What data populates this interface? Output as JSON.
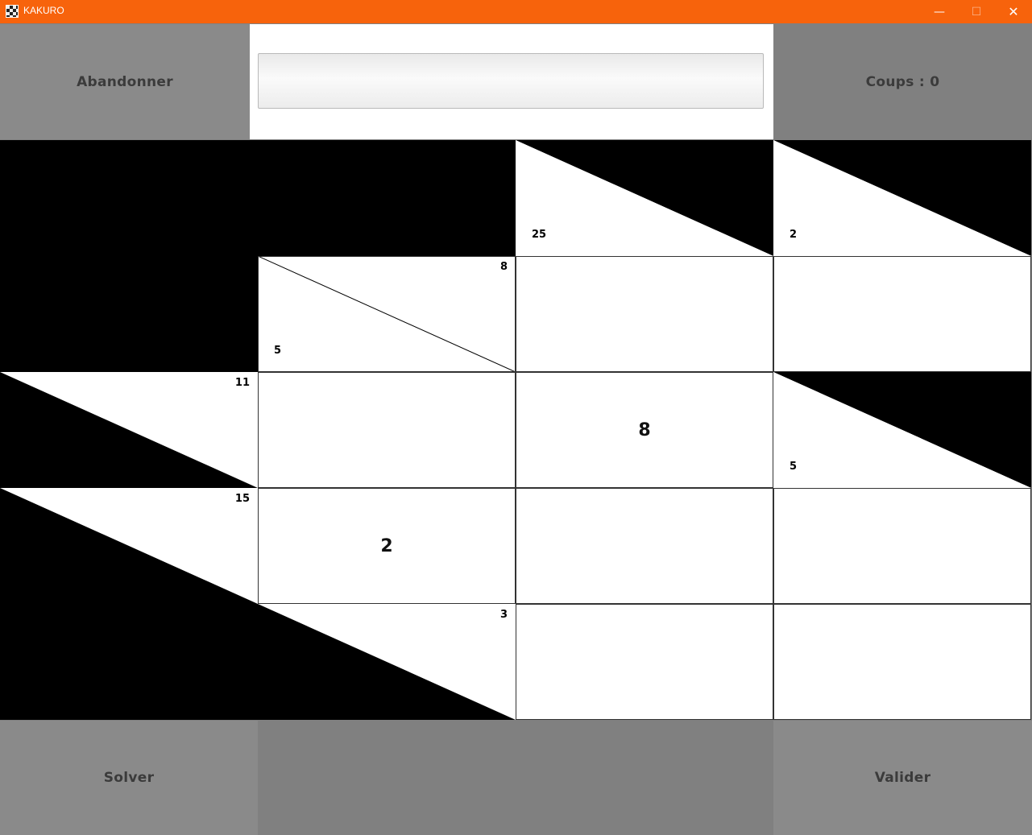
{
  "window": {
    "title": "KAKURO",
    "minimize_glyph": "—",
    "maximize_glyph": "☐",
    "close_glyph": "✕"
  },
  "colors": {
    "titlebar": "#f7630c",
    "panel": "#808080",
    "black_cell": "#000000",
    "white_cell": "#ffffff"
  },
  "toolbar": {
    "abandon_label": "Abandonner",
    "message": "",
    "moves_label": "Coups : 0"
  },
  "bottom": {
    "solver_label": "Solver",
    "validate_label": "Valider"
  },
  "grid": {
    "rows": 5,
    "cols": 4,
    "cells": [
      [
        {
          "type": "black"
        },
        {
          "type": "black"
        },
        {
          "type": "clue",
          "down": "25",
          "across": ""
        },
        {
          "type": "clue",
          "down": "2",
          "across": ""
        }
      ],
      [
        {
          "type": "black"
        },
        {
          "type": "clue",
          "down": "5",
          "across": "8"
        },
        {
          "type": "white",
          "value": ""
        },
        {
          "type": "white",
          "value": ""
        }
      ],
      [
        {
          "type": "clue",
          "down": "",
          "across": "11"
        },
        {
          "type": "white",
          "value": ""
        },
        {
          "type": "white",
          "value": "8"
        },
        {
          "type": "clue",
          "down": "5",
          "across": ""
        }
      ],
      [
        {
          "type": "clue",
          "down": "",
          "across": "15"
        },
        {
          "type": "white",
          "value": "2"
        },
        {
          "type": "white",
          "value": ""
        },
        {
          "type": "white",
          "value": ""
        }
      ],
      [
        {
          "type": "black"
        },
        {
          "type": "clue",
          "down": "",
          "across": "3"
        },
        {
          "type": "white",
          "value": ""
        },
        {
          "type": "white",
          "value": ""
        }
      ]
    ]
  }
}
